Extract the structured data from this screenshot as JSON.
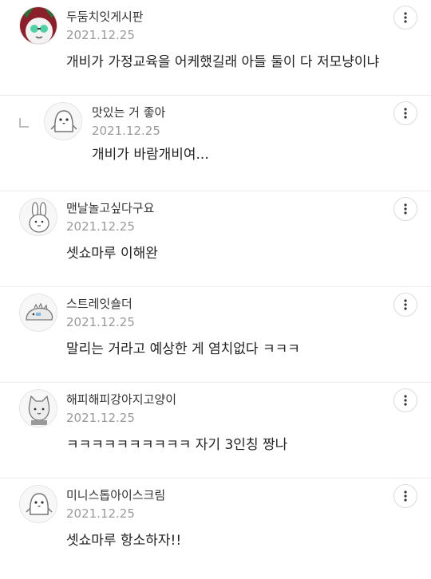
{
  "comments": [
    {
      "nickname": "두둠치잇게시판",
      "date": "2021.12.25",
      "text": "개비가 가정교육을 어케했길래 아들 둘이 다 저모냥이냐",
      "avatar": "green-glasses-character-avatar"
    },
    {
      "nickname": "맛있는 거 좋아",
      "date": "2021.12.25",
      "text": "개비가 바람개비여...",
      "avatar": "penguin-avatar",
      "reply": true
    },
    {
      "nickname": "맨날놀고싶다구요",
      "date": "2021.12.25",
      "text": "셋쇼마루 이해완",
      "avatar": "bunny-avatar"
    },
    {
      "nickname": "스트레잇숄더",
      "date": "2021.12.25",
      "text": "말리는 거라고 예상한 게 염치없다 ㅋㅋㅋ",
      "avatar": "dinosaur-avatar"
    },
    {
      "nickname": "해피해피강아지고양이",
      "date": "2021.12.25",
      "text": "ㅋㅋㅋㅋㅋㅋㅋㅋㅋㅋ 자기 3인칭 짱나",
      "avatar": "cat-avatar"
    },
    {
      "nickname": "미니스톱아이스크림",
      "date": "2021.12.25",
      "text": "셋쇼마루 항소하자!!",
      "avatar": "penguin-avatar"
    }
  ],
  "icons": {
    "more": "more-vertical-icon",
    "reply": "reply-arrow-icon"
  },
  "colors": {
    "date": "#9a9a9a",
    "divider": "#ececec",
    "text": "#222222"
  }
}
